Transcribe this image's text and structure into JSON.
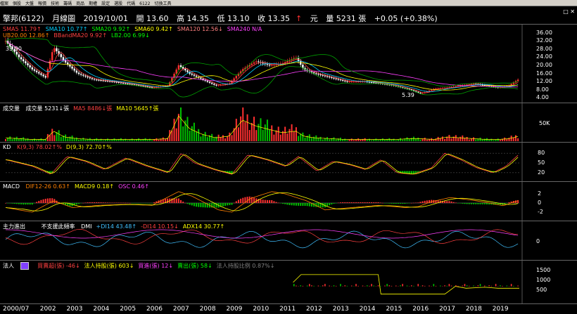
{
  "toolbar": {
    "labels": [
      "檔案",
      "個股",
      "大盤",
      "報價",
      "技術",
      "籌碼",
      "商品",
      "期權",
      "設定",
      "選股",
      "代碼",
      "6122",
      "切換工具"
    ]
  },
  "title": {
    "name": "擎邦(6122)",
    "period": "月線圖",
    "date": "2019/10/01",
    "open": "開 13.60",
    "high": "高 14.35",
    "low": "低 13.10",
    "close": "收 13.35",
    "unit": "元",
    "volume": "量 5231 張",
    "change": "+0.05 (+0.38%)"
  },
  "price_panel": {
    "legend_row1": [
      "SMA5 11.79↑",
      "SMA10 10.77↑",
      "SMA20 9.92↑",
      "SMA60 9.42↑",
      "SMA120 12.56↓",
      "SMA240 N/A"
    ],
    "legend_row2": [
      "UB20.00 12.86↑",
      "BBandMA20 9.92↑",
      "LB2.00 6.99↓"
    ],
    "legend_colors": [
      "#ff4040",
      "#00d0ff",
      "#00ff00",
      "#ffff00",
      "#ff8080",
      "#ff40ff"
    ],
    "legend2_colors": [
      "#ff8000",
      "#ff4040",
      "#00ff00"
    ],
    "scale": [
      "36.00",
      "32.00",
      "28.00",
      "24.00",
      "20.00",
      "16.00",
      "12.00",
      "8.00",
      "4.00"
    ],
    "scale_values": [
      36,
      32,
      28,
      24,
      20,
      16,
      12,
      8,
      4
    ],
    "marks": {
      "high": "35.90",
      "low": "5.39"
    }
  },
  "volume_panel": {
    "label": "成交量",
    "legend": [
      "成交量 5231↓張",
      "MA5 8486↓張",
      "MA10 5645↑張"
    ],
    "legend_colors": [
      "#ffffff",
      "#ff4040",
      "#ffff00"
    ],
    "scale": [
      "50K"
    ]
  },
  "kd_panel": {
    "label": "KD",
    "legend": [
      "K(9,3) 78.02↑%",
      "D(9,3) 72.70↑%"
    ],
    "legend_colors": [
      "#ff4040",
      "#ffff00"
    ],
    "scale": [
      "80",
      "50",
      "20"
    ],
    "scale_values": [
      80,
      50,
      20
    ]
  },
  "macd_panel": {
    "label": "MACD",
    "legend": [
      "DIF12-26 0.63↑",
      "MACD9 0.18↑",
      "OSC 0.46↑"
    ],
    "legend_colors": [
      "#ff8000",
      "#ffff00",
      "#ff40ff"
    ],
    "scale": [
      "2",
      "0",
      "-2"
    ],
    "scale_values": [
      2,
      0,
      -2
    ]
  },
  "dmi_panel": {
    "label": "主力進出",
    "sublabel": "不支援此頻率",
    "legend": [
      "DMI",
      "+DI14 43.48↑",
      "-DI14 10.15↓",
      "ADX14 30.77↑"
    ],
    "legend_colors": [
      "#ffffff",
      "#40c0ff",
      "#ff4040",
      "#ffff00"
    ],
    "scale": [
      "0"
    ]
  },
  "inst_panel": {
    "label": "法人",
    "legend": [
      "買賣超(張) -46↓",
      "法人持股(張) 603↓",
      "買進(張) 12↓",
      "賣出(張) 58↓",
      "法人持股比例 0.87%↓"
    ],
    "legend_colors": [
      "#ff4040",
      "#ffff00",
      "#ff40ff",
      "#00ff00",
      "#808080"
    ],
    "scale": [
      "1500",
      "1000",
      "500"
    ],
    "scale_values": [
      1500,
      1000,
      500
    ]
  },
  "x_axis": {
    "labels": [
      "2000/07",
      "2002",
      "2003",
      "2004",
      "2005",
      "2006",
      "2007",
      "2008",
      "2009",
      "2010",
      "2011",
      "2012",
      "2013",
      "2014",
      "2015",
      "2016",
      "2017",
      "2018",
      "2019"
    ],
    "label_values": [
      2000.5,
      2002,
      2003,
      2004,
      2005,
      2006,
      2007,
      2008,
      2009,
      2010,
      2011,
      2012,
      2013,
      2014,
      2015,
      2016,
      2017,
      2018,
      2019
    ]
  },
  "chart_data": {
    "type": "line",
    "title": "擎邦(6122) 月線圖",
    "x_range": [
      2000.5,
      2019.8
    ],
    "close_anchors": {
      "x": [
        2000.5,
        2001.0,
        2001.5,
        2002.0,
        2002.3,
        2002.7,
        2003.2,
        2003.8,
        2004.5,
        2005.3,
        2006.0,
        2006.6,
        2007.0,
        2007.4,
        2007.9,
        2008.4,
        2008.9,
        2009.4,
        2009.9,
        2010.4,
        2010.9,
        2011.4,
        2011.7,
        2012.1,
        2012.7,
        2013.3,
        2014.0,
        2014.6,
        2015.1,
        2015.7,
        2016.1,
        2016.6,
        2017.1,
        2017.6,
        2018.1,
        2018.6,
        2019.0,
        2019.4,
        2019.8
      ],
      "y": [
        32,
        24,
        18,
        14,
        29,
        22,
        16,
        13,
        12,
        10.5,
        9,
        10,
        20,
        16,
        13,
        10,
        11,
        18,
        22,
        20,
        21,
        24,
        18,
        16,
        14,
        12,
        12,
        11,
        10,
        8,
        6,
        8.5,
        9,
        10,
        11,
        10,
        9,
        10,
        13.35
      ]
    },
    "volume_k": [
      4,
      3,
      2,
      2,
      12,
      5,
      3,
      2,
      2,
      2,
      2,
      3,
      30,
      15,
      8,
      4,
      6,
      25,
      18,
      14,
      10,
      12,
      6,
      4,
      3,
      2,
      2,
      2,
      2,
      3,
      3,
      2,
      5,
      4,
      3,
      2,
      2,
      3,
      6
    ],
    "kd_anchors": {
      "x": [
        2000.5,
        2001.5,
        2002.2,
        2002.8,
        2003.5,
        2004.2,
        2005.0,
        2005.8,
        2006.6,
        2007.1,
        2007.6,
        2008.3,
        2009.0,
        2009.6,
        2010.3,
        2011.0,
        2011.5,
        2012.2,
        2012.8,
        2013.4,
        2014.0,
        2014.6,
        2015.2,
        2015.8,
        2016.5,
        2017.0,
        2017.6,
        2018.2,
        2018.8,
        2019.3,
        2019.8
      ],
      "k": [
        60,
        40,
        15,
        70,
        55,
        30,
        65,
        40,
        20,
        80,
        50,
        30,
        15,
        75,
        60,
        40,
        70,
        25,
        55,
        45,
        30,
        60,
        20,
        15,
        35,
        80,
        60,
        35,
        20,
        40,
        78
      ]
    },
    "macd_anchors": {
      "x": [
        2000.5,
        2001.5,
        2002.3,
        2003.0,
        2004.0,
        2005.0,
        2006.0,
        2007.0,
        2007.5,
        2008.5,
        2009.0,
        2009.7,
        2010.5,
        2011.0,
        2011.8,
        2012.5,
        2013.5,
        2014.5,
        2015.5,
        2016.0,
        2016.5,
        2017.2,
        2017.8,
        2018.5,
        2019.2,
        2019.8
      ],
      "dif": [
        -1,
        -2,
        0.5,
        -1,
        -0.5,
        -0.3,
        -0.5,
        2.5,
        1.5,
        -1.5,
        -2,
        1,
        2.5,
        2,
        0.5,
        -1.5,
        -1,
        -0.5,
        -1,
        -0.8,
        0.3,
        1.2,
        0.8,
        0.2,
        -0.6,
        0.63
      ]
    },
    "inst_holdings": {
      "x": [
        2011.3,
        2011.6,
        2012.0,
        2012.5,
        2013.0,
        2013.5,
        2014.0,
        2014.5,
        2014.6,
        2015.0,
        2016.0,
        2017.0,
        2017.4,
        2017.8,
        2018.5,
        2019.0,
        2019.8
      ],
      "y": [
        900,
        1300,
        1300,
        1300,
        1300,
        1300,
        1300,
        1300,
        300,
        300,
        300,
        300,
        700,
        600,
        650,
        600,
        603
      ]
    }
  }
}
